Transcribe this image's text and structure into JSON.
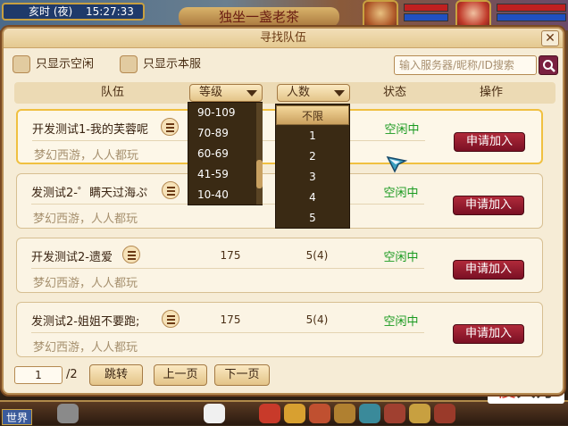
{
  "hud": {
    "time_label": "亥时 (夜)",
    "clock": "15:27:33",
    "banner": "独坐一盏老茶"
  },
  "dialog": {
    "title": "寻找队伍",
    "close": "✕",
    "filters": {
      "only_idle": "只显示空闲",
      "only_this_server": "只显示本服"
    },
    "search_placeholder": "输入服务器/昵称/ID搜索",
    "columns": {
      "team": "队伍",
      "level": "等级",
      "count": "人数",
      "status": "状态",
      "action": "操作"
    },
    "level_options": [
      "90-109",
      "70-89",
      "60-69",
      "41-59",
      "10-40"
    ],
    "count_options": [
      "不限",
      "1",
      "2",
      "3",
      "4",
      "5"
    ],
    "count_selected": "不限",
    "teams": [
      {
        "name": "开发测试1-我的芙蓉呢",
        "slogan": "梦幻西游，人人都玩",
        "level": "",
        "count": "",
        "status": "空闲中",
        "action": "申请加入"
      },
      {
        "name": "发测试2-゜瞒天过海ぷ",
        "slogan": "梦幻西游，人人都玩",
        "level": "",
        "count": "",
        "status": "空闲中",
        "action": "申请加入"
      },
      {
        "name": "开发测试2-遗爱",
        "slogan": "梦幻西游，人人都玩",
        "level": "175",
        "count": "5(4)",
        "status": "空闲中",
        "action": "申请加入"
      },
      {
        "name": "发测试2-姐姐不要跑;",
        "slogan": "梦幻西游，人人都玩",
        "level": "175",
        "count": "5(4)",
        "status": "空闲中",
        "action": "申请加入"
      }
    ],
    "pager": {
      "current": "1",
      "total": "/2",
      "goto": "跳转",
      "prev": "上一页",
      "next": "下一页"
    }
  },
  "bottom": {
    "world": "世界",
    "watermark_a": "傻",
    "watermark_b": "大方"
  }
}
